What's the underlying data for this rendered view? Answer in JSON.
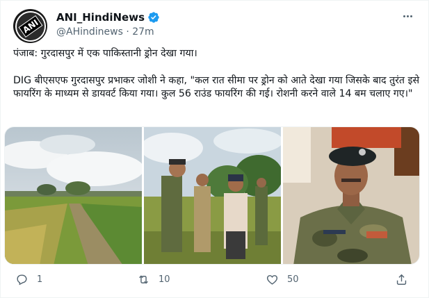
{
  "tweet": {
    "author_name": "ANI_HindiNews",
    "handle": "@AHindinews",
    "separator": "·",
    "time": "27m",
    "avatar_text": "ANI",
    "line1": "पंजाब: गुरदासपुर में एक पाकिस्तानी ड्रोन देखा गया।",
    "line2": "DIG बीएसएफ गुरदासपुर प्रभाकर जोशी ने कहा, \"कल रात सीमा पर ड्रोन को आते देखा गया जिसके बाद तुरंत इसे फायरिंग के माध्यम से डायवर्ट किया गया। कुल 56 राउंड फायरिंग की गई। रोशनी करने वाले 14 बम चलाए गए।\""
  },
  "media": {
    "images": [
      {
        "name": "field-photo"
      },
      {
        "name": "officials-photo"
      },
      {
        "name": "dig-photo"
      }
    ]
  },
  "actions": {
    "reply_count": "1",
    "retweet_count": "10",
    "like_count": "50"
  },
  "colors": {
    "text": "#0f1419",
    "secondary": "#536471",
    "verified": "#1d9bf0"
  },
  "icons": [
    "verified-badge-icon",
    "more-icon",
    "reply-icon",
    "retweet-icon",
    "like-icon",
    "share-icon"
  ]
}
